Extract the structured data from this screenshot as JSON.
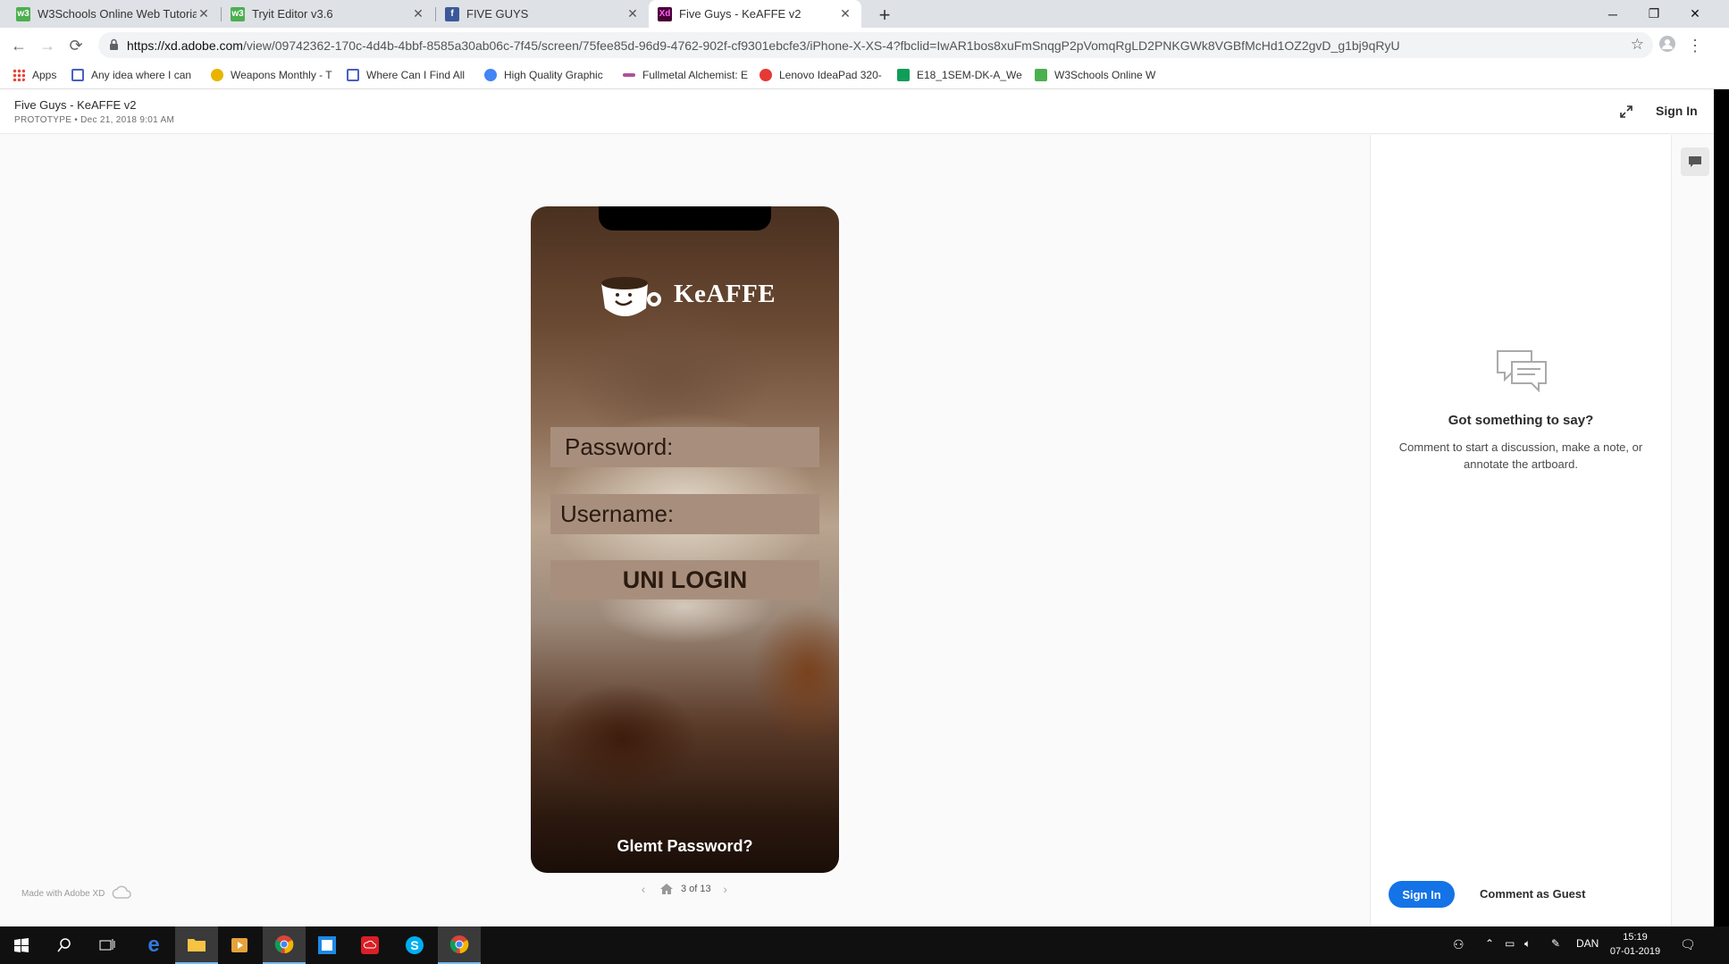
{
  "tabs": [
    {
      "title": "W3Schools Online Web Tutorials",
      "icon": "w3schools-icon",
      "active": false
    },
    {
      "title": "Tryit Editor v3.6",
      "icon": "w3schools-icon",
      "active": false
    },
    {
      "title": "FIVE GUYS",
      "icon": "facebook-icon",
      "active": false
    },
    {
      "title": "Five Guys - KeAFFE v2",
      "icon": "adobe-xd-icon",
      "active": true
    }
  ],
  "browser": {
    "url_host": "https://xd.adobe.com",
    "url_path": "/view/09742362-170c-4d4b-4bbf-8585a30ab06c-7f45/screen/75fee85d-96d9-4762-902f-cf9301ebcfe3/iPhone-X-XS-4?fbclid=IwAR1bos8xuFmSnqgP2pVomqRgLD2PNKGWk8VGBfMcHd1OZ2gvD_g1bj9qRyU"
  },
  "bookmarks": [
    {
      "label": "Apps"
    },
    {
      "label": "Any idea where I can"
    },
    {
      "label": "Weapons Monthly - T"
    },
    {
      "label": "Where Can I Find All"
    },
    {
      "label": "High Quality Graphic"
    },
    {
      "label": "Fullmetal Alchemist: E"
    },
    {
      "label": "Lenovo IdeaPad 320-"
    },
    {
      "label": "E18_1SEM-DK-A_We"
    },
    {
      "label": "W3Schools Online W"
    }
  ],
  "xd": {
    "doc_title": "Five Guys - KeAFFE v2",
    "doc_meta": "PROTOTYPE  •  Dec 21, 2018 9:01 AM",
    "sign_in": "Sign In",
    "made_with": "Made with Adobe XD",
    "pager": "3 of 13"
  },
  "app": {
    "brand": "KeAFFE",
    "password_label": "Password:",
    "username_label": "Username:",
    "login_button": "UNI LOGIN",
    "forgot": "Glemt Password?"
  },
  "comments": {
    "title": "Got something to say?",
    "description": "Comment to start a discussion, make a note, or annotate the artboard.",
    "sign_in": "Sign In",
    "guest": "Comment as Guest"
  },
  "taskbar": {
    "language": "DAN",
    "time": "15:19",
    "date": "07-01-2019"
  },
  "colors": {
    "accent_blue": "#1473e6",
    "field_bg": "#a88f7d",
    "field_text": "#2b1a10"
  }
}
